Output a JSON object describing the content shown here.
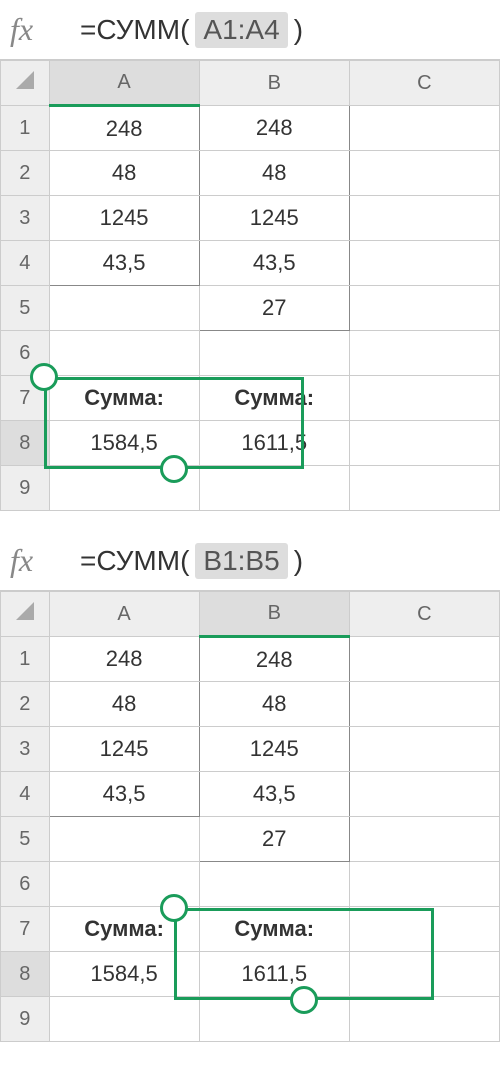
{
  "panels": [
    {
      "formula": {
        "prefix": "=СУММ( ",
        "range": "A1:A4",
        "suffix": " )"
      },
      "columns": [
        "A",
        "B",
        "C"
      ],
      "rows": [
        "1",
        "2",
        "3",
        "4",
        "5",
        "6",
        "7",
        "8",
        "9"
      ],
      "selected_col": "A",
      "selected_row": "8",
      "cells": {
        "A1": "248",
        "B1": "248",
        "A2": "48",
        "B2": "48",
        "A3": "1245",
        "B3": "1245",
        "A4": "43,5",
        "B4": "43,5",
        "B5": "27",
        "A7": "Сумма:",
        "B7": "Сумма:",
        "A8": "1584,5",
        "B8": "1611,5"
      },
      "selection": {
        "from": "A7",
        "to": "B8"
      },
      "handles": [
        "top-left",
        "bottom-right"
      ]
    },
    {
      "formula": {
        "prefix": "=СУММ( ",
        "range": "B1:B5",
        "suffix": " )"
      },
      "columns": [
        "A",
        "B",
        "C"
      ],
      "rows": [
        "1",
        "2",
        "3",
        "4",
        "5",
        "6",
        "7",
        "8",
        "9"
      ],
      "selected_col": "B",
      "selected_row": "8",
      "cells": {
        "A1": "248",
        "B1": "248",
        "A2": "48",
        "B2": "48",
        "A3": "1245",
        "B3": "1245",
        "A4": "43,5",
        "B4": "43,5",
        "B5": "27",
        "A7": "Сумма:",
        "B7": "Сумма:",
        "A8": "1584,5",
        "B8": "1611,5"
      },
      "selection": {
        "from": "B7",
        "to": "C8"
      },
      "handles": [
        "top-left",
        "bottom-right"
      ]
    }
  ],
  "chart_data": {
    "type": "table",
    "title": "Spreadsheet СУММ example",
    "columns": [
      "A",
      "B"
    ],
    "rows": [
      {
        "A": 248,
        "B": 248
      },
      {
        "A": 48,
        "B": 48
      },
      {
        "A": 1245,
        "B": 1245
      },
      {
        "A": 43.5,
        "B": 43.5
      },
      {
        "A": null,
        "B": 27
      }
    ],
    "summary": {
      "A_sum": 1584.5,
      "B_sum": 1611.5
    }
  }
}
